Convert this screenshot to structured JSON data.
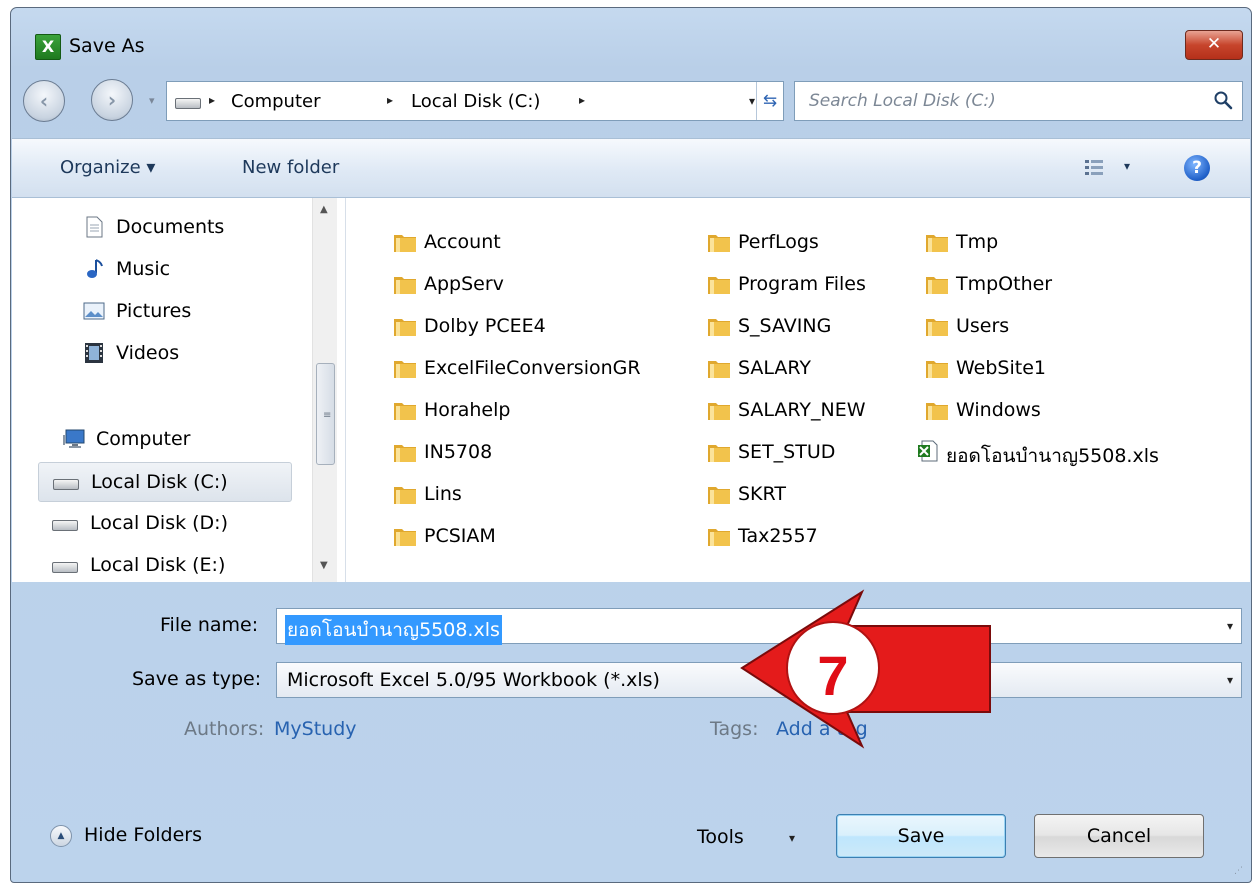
{
  "window": {
    "title": "Save As",
    "app_icon_glyph": "X",
    "close_glyph": "✕"
  },
  "address": {
    "back_glyph": "‹",
    "forward_glyph": "›",
    "breadcrumbs": [
      "Computer",
      "Local Disk (C:)"
    ],
    "separator": "▸",
    "dropdown_glyph": "▾",
    "refresh_glyph": "⇆"
  },
  "search": {
    "placeholder": "Search Local Disk (C:)"
  },
  "toolbar": {
    "organize_label": "Organize ▾",
    "new_folder_label": "New folder",
    "views_arrow": "▾",
    "help_glyph": "?"
  },
  "nav": {
    "items": [
      {
        "label": "Documents",
        "icon": "documents-icon"
      },
      {
        "label": "Music",
        "icon": "music-icon"
      },
      {
        "label": "Pictures",
        "icon": "pictures-icon"
      },
      {
        "label": "Videos",
        "icon": "videos-icon"
      },
      {
        "label": "Computer",
        "icon": "computer-icon"
      },
      {
        "label": "Local Disk (C:)",
        "icon": "drive-icon",
        "selected": true
      },
      {
        "label": "Local Disk (D:)",
        "icon": "drive-icon"
      },
      {
        "label": "Local Disk (E:)",
        "icon": "drive-icon"
      }
    ],
    "scroll_up": "▲",
    "scroll_down": "▼",
    "grip": "≡"
  },
  "files": {
    "columns": [
      [
        "Account",
        "AppServ",
        "Dolby PCEE4",
        "ExcelFileConversionGR",
        "Horahelp",
        "IN5708",
        "Lins",
        "PCSIAM"
      ],
      [
        "PerfLogs",
        "Program Files",
        "S_SAVING",
        "SALARY",
        "SALARY_NEW",
        "SET_STUD",
        "SKRT",
        "Tax2557"
      ],
      [
        "Tmp",
        "TmpOther",
        "Users",
        "WebSite1",
        "Windows"
      ]
    ],
    "xls_file": "ยอดโอนบำนาญ5508.xls"
  },
  "form": {
    "file_name_label": "File name:",
    "file_name_value": "ยอดโอนบำนาญ5508.xls",
    "save_type_label": "Save as type:",
    "save_type_value": "Microsoft Excel 5.0/95 Workbook (*.xls)",
    "authors_label": "Authors:",
    "authors_value": "MyStudy",
    "tags_label": "Tags:",
    "tags_value": "Add a tag",
    "dropdown_glyph": "▾"
  },
  "footer": {
    "hide_folders_label": "Hide Folders",
    "hide_folders_glyph": "▲",
    "tools_label": "Tools",
    "tools_arrow": "▾",
    "save_label": "Save",
    "cancel_label": "Cancel",
    "resize_grip": "⋰"
  },
  "annotation": {
    "step_number": "7",
    "arrow_color": "#e41b1b"
  },
  "colors": {
    "selection": "#3399ff",
    "link": "#2762b0",
    "folder": "#f2c34c"
  }
}
